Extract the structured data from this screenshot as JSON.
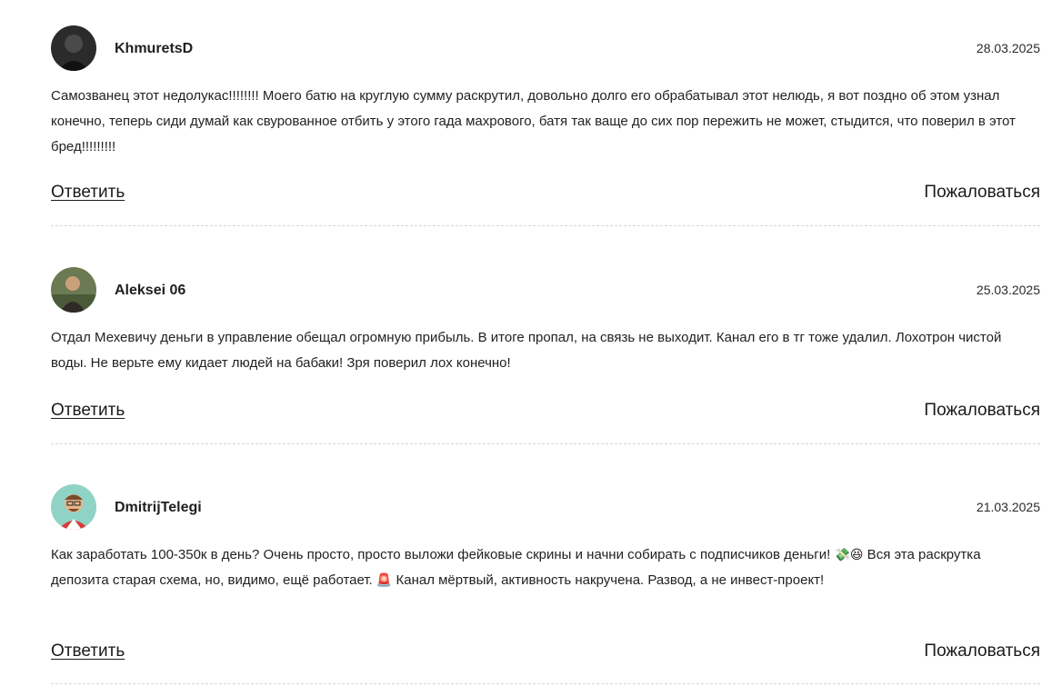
{
  "comments": [
    {
      "author": "KhmuretsD",
      "date": "28.03.2025",
      "text": "Самозванец этот недолукас!!!!!!!! Моего батю на круглую сумму раскрутил, довольно долго его обрабатывал этот нелюдь, я вот поздно об этом узнал конечно, теперь сиди думай как свурованное отбить у этого гада махрового, батя так ваще до сих пор пережить не может, стыдится, что поверил в этот бред!!!!!!!!!",
      "reply_label": "Ответить",
      "report_label": "Пожаловаться"
    },
    {
      "author": "Aleksei 06",
      "date": "25.03.2025",
      "text": "Отдал Мехевичу деньги в управление обещал огромную прибыль. В итоге пропал, на связь не выходит. Канал его в тг тоже удалил. Лохотрон чистой воды. Не верьте ему кидает людей на бабаки! Зря поверил лох конечно!",
      "reply_label": "Ответить",
      "report_label": "Пожаловаться"
    },
    {
      "author": "DmitrijTelegi",
      "date": "21.03.2025",
      "text_part1": "Как заработать 100-350к в день? Очень просто, просто выложи фейковые скрины и начни собирать с подписчиков деньги! ",
      "emoji1": "💸😆",
      "text_part2": " Вся эта раскрутка депозита старая схема, но, видимо, ещё работает. ",
      "emoji2": "🚨",
      "text_part3": " Канал мёртвый, активность накручена. Развод, а не инвест-проект!",
      "reply_label": "Ответить",
      "report_label": "Пожаловаться"
    }
  ],
  "icons": {
    "avatar_1": "user-avatar-dark-photo",
    "avatar_2": "user-avatar-photo",
    "avatar_3": "user-avatar-cartoon"
  }
}
